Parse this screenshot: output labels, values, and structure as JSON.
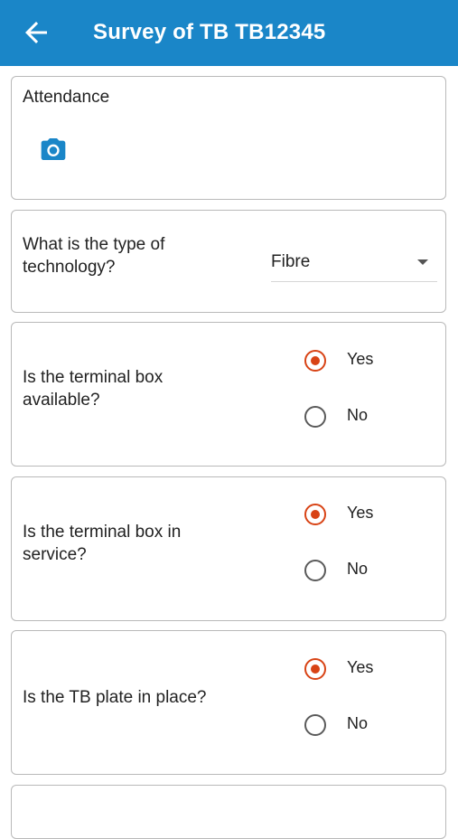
{
  "appbar": {
    "title": "Survey of TB TB12345",
    "back_icon": "arrow-left-icon",
    "background": "#1a86c8"
  },
  "attendance": {
    "label": "Attendance",
    "camera_icon": "camera-icon"
  },
  "technology": {
    "label": "What is the type of technology?",
    "selected_value": "Fibre"
  },
  "questions": [
    {
      "label": "Is the terminal box available?",
      "options": [
        "Yes",
        "No"
      ],
      "selected": "Yes"
    },
    {
      "label": "Is the terminal box in service?",
      "options": [
        "Yes",
        "No"
      ],
      "selected": "Yes"
    },
    {
      "label": "Is the TB plate in place?",
      "options": [
        "Yes",
        "No"
      ],
      "selected": "Yes"
    }
  ],
  "colors": {
    "accent": "#d84315",
    "border": "#b9b9b9"
  }
}
